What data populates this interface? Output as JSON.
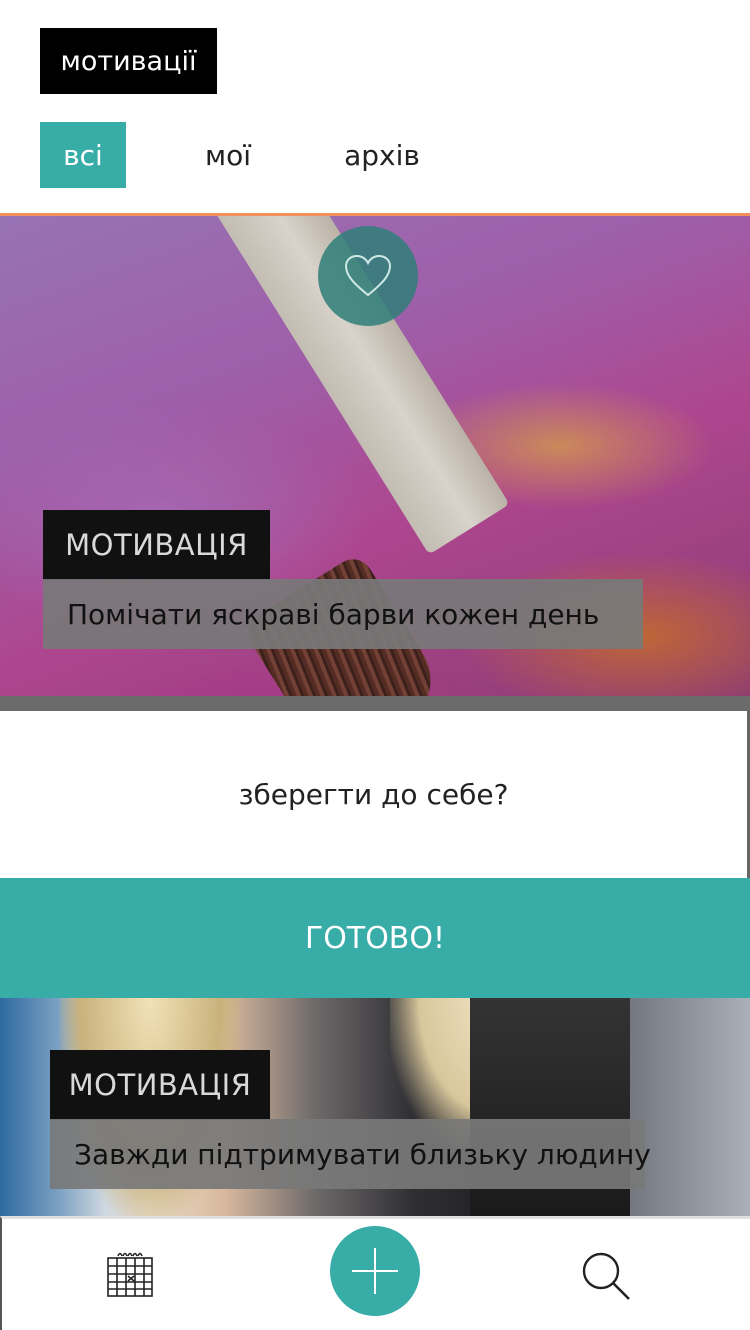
{
  "header": {
    "title": "мотивації"
  },
  "tabs": [
    {
      "label": "всі",
      "active": true
    },
    {
      "label": "мої",
      "active": false
    },
    {
      "label": "архів",
      "active": false
    }
  ],
  "cards": [
    {
      "tag": "МОТИВАЦІЯ",
      "caption": "Помічати яскраві барви кожен день"
    },
    {
      "tag": "МОТИВАЦІЯ",
      "caption": "Завжди підтримувати близьку людину"
    }
  ],
  "dialog": {
    "question": "зберегти до себе?",
    "confirm_label": "ГОТОВО!"
  },
  "icons": {
    "heart": "heart-icon",
    "calendar": "calendar-icon",
    "add": "plus-icon",
    "search": "search-icon"
  },
  "colors": {
    "accent": "#38ada8",
    "tag_bg": "#111111",
    "caption_bg": "#787878"
  }
}
